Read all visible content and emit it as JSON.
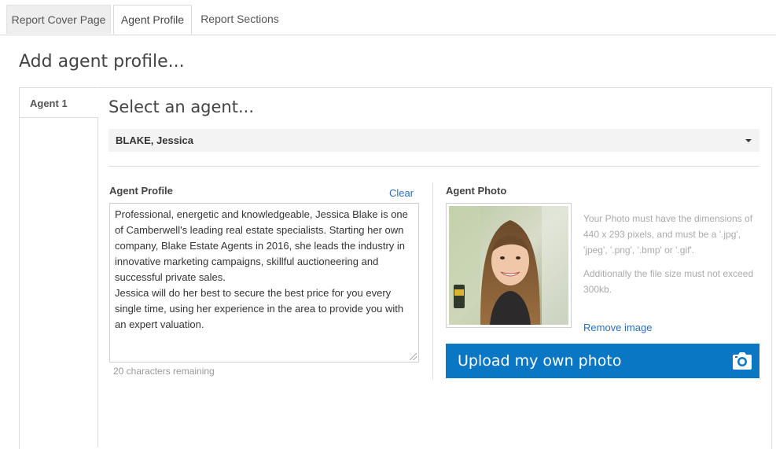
{
  "tabs": [
    {
      "label": "Report Cover Page"
    },
    {
      "label": "Agent Profile"
    },
    {
      "label": "Report Sections"
    }
  ],
  "page_title": "Add agent profile...",
  "agent_tab": {
    "label": "Agent 1"
  },
  "select_agent": {
    "heading": "Select an agent...",
    "selected": "BLAKE, Jessica"
  },
  "profile": {
    "label": "Agent Profile",
    "clear_label": "Clear",
    "text": "Professional, energetic and knowledgeable, Jessica Blake is one of Camberwell's leading real estate specialists. Starting her own company, Blake Estate Agents in 2016, she leads the industry in innovative marketing campaigns, skillful auctioneering and successful private sales.\nJessica will do her best to secure the best price for you every single time, using her experience in the area to provide you with an expert valuation.",
    "chars_remaining": "20 characters remaining"
  },
  "photo": {
    "label": "Agent Photo",
    "hint_dimensions": "Your Photo must have the dimensions of 440 x 293 pixels, and must be a '.jpg', 'jpeg', '.png', '.bmp' or '.gif'.",
    "hint_size": "Additionally the file size must not exceed 300kb.",
    "remove_label": "Remove image",
    "upload_label": "Upload my own photo",
    "upload_icon": "camera-icon"
  },
  "colors": {
    "accent": "#0a77c4",
    "link": "#2a6ebb"
  }
}
